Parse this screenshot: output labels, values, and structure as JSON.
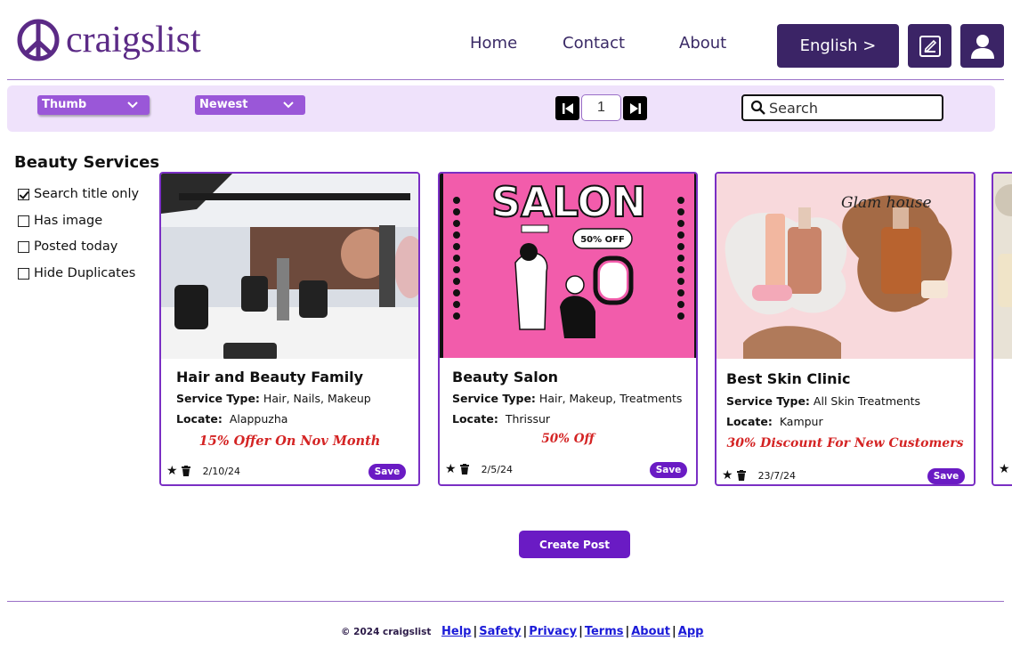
{
  "brand": {
    "name": "craigslist",
    "color": "#5b2a86",
    "accent": "#6a1bc4"
  },
  "nav": {
    "home": "Home",
    "contact": "Contact",
    "about": "About"
  },
  "language_button": "English  >",
  "toolbar": {
    "view_select": "Thumb",
    "sort_select": "Newest",
    "page": "1",
    "search_placeholder": "Search"
  },
  "sidebar": {
    "title": "Beauty Services",
    "filters": [
      {
        "label": "Search title only",
        "checked": true
      },
      {
        "label": "Has image",
        "checked": false
      },
      {
        "label": "Posted today",
        "checked": false
      },
      {
        "label": "Hide Duplicates",
        "checked": false
      }
    ]
  },
  "cards": [
    {
      "title": "Hair and Beauty Family",
      "service_label": "Service Type:",
      "service": "Hair, Nails, Makeup",
      "locate_label": "Locate:",
      "locate": "Alappuzha",
      "offer": "15% Offer On Nov Month",
      "date": "2/10/24",
      "save": "Save"
    },
    {
      "title": "Beauty Salon",
      "service_label": "Service Type:",
      "service": "Hair, Makeup, Treatments",
      "locate_label": "Locate:",
      "locate": "Thrissur",
      "offer": "50% Off",
      "date": "2/5/24",
      "save": "Save",
      "image_text": {
        "heading": "SALON",
        "badge": "50% OFF"
      }
    },
    {
      "title": "Best Skin Clinic",
      "service_label": "Service Type:",
      "service": "All Skin Treatments",
      "locate_label": "Locate:",
      "locate": "Kampur",
      "offer": "30% Discount For New Customers",
      "date": "23/7/24",
      "save": "Save",
      "image_text": {
        "script": "Glam house"
      }
    }
  ],
  "create_post": "Create Post",
  "footer": {
    "copyright": "© 2024 craigslist",
    "links": [
      "Help",
      "Safety",
      "Privacy",
      "Terms",
      "About",
      "App"
    ]
  }
}
